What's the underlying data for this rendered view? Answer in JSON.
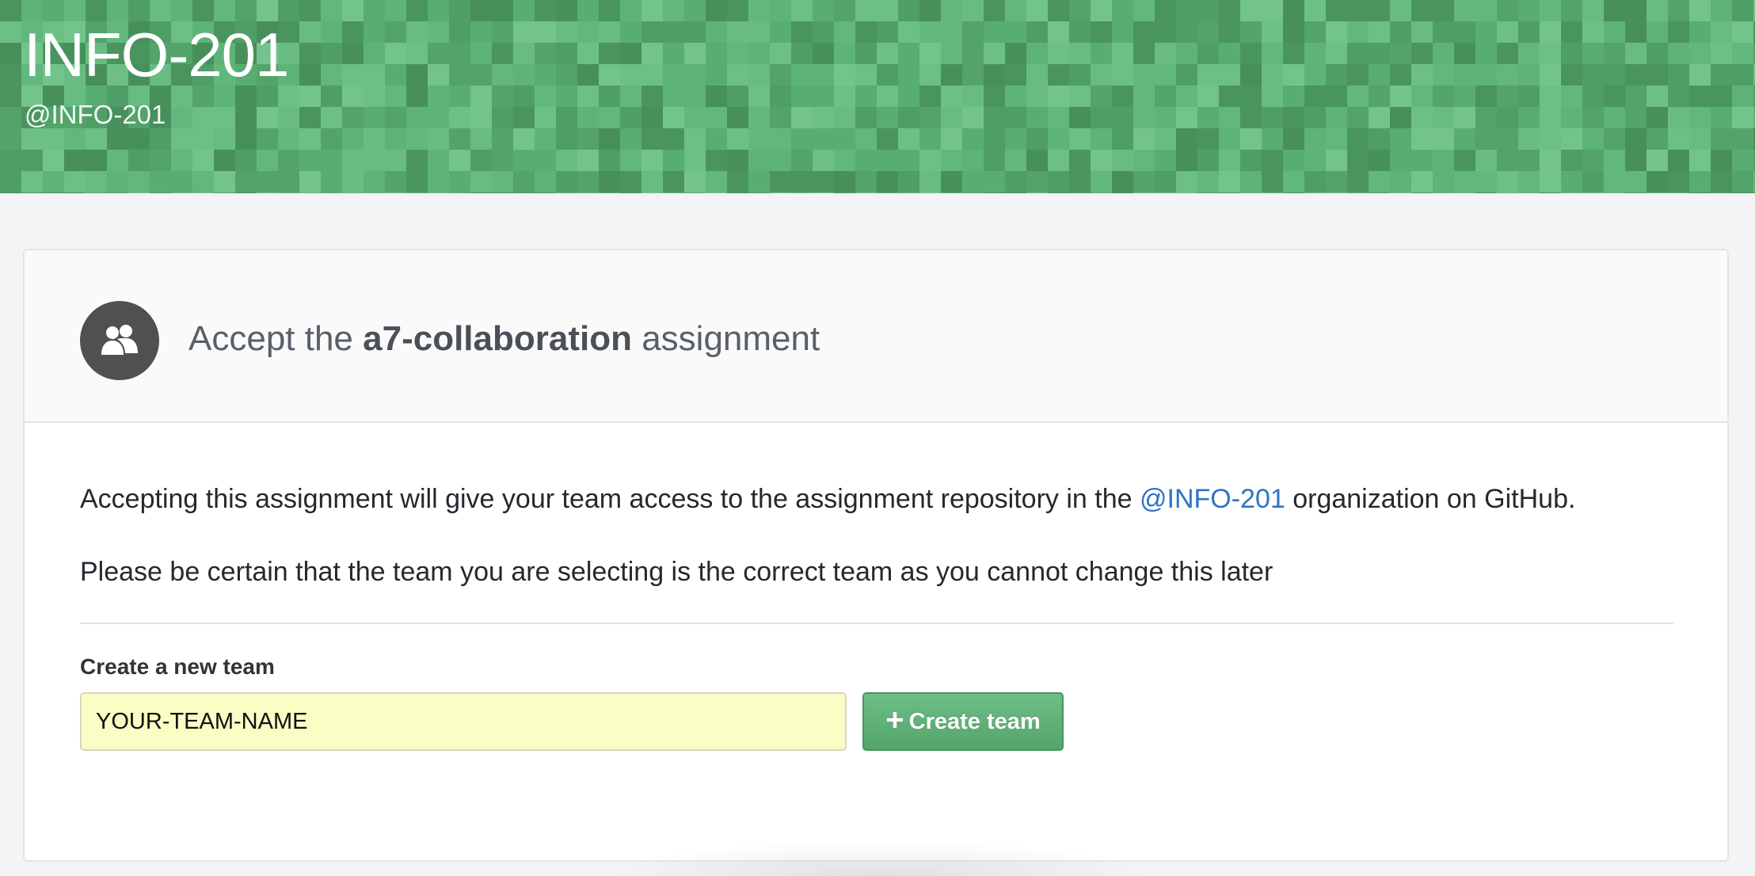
{
  "banner": {
    "org_name": "INFO-201",
    "org_handle": "@INFO-201",
    "color": "#58ad72"
  },
  "card": {
    "header": {
      "avatar_icon": "people-icon",
      "title_prefix": "Accept the ",
      "assignment_name": "a7-collaboration",
      "title_suffix": " assignment"
    },
    "description": {
      "before_link": "Accepting this assignment will give your team access to the assignment repository in the ",
      "org_link": "@INFO-201",
      "after_link": " organization on GitHub."
    },
    "warning": "Please be certain that the team you are selecting is the correct team as you cannot change this later",
    "form": {
      "label": "Create a new team",
      "input_value": "YOUR-TEAM-NAME",
      "button_label": "Create team",
      "button_icon": "plus-icon"
    }
  },
  "colors": {
    "link": "#2f73c6",
    "button": "#5cb176",
    "input_highlight": "#fafdc4"
  }
}
